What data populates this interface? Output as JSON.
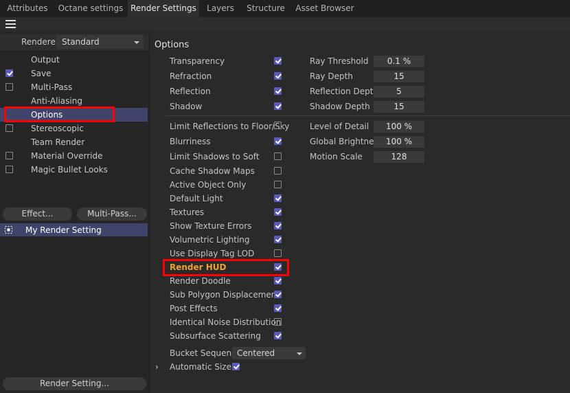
{
  "tabs": [
    {
      "label": "Attributes",
      "active": false
    },
    {
      "label": "Octane settings",
      "active": false
    },
    {
      "label": "Render Settings",
      "active": true
    },
    {
      "label": "Layers",
      "active": false
    },
    {
      "label": "Structure",
      "active": false
    },
    {
      "label": "Asset Browser",
      "active": false
    }
  ],
  "menu": {
    "icon": "hamburger-menu-icon"
  },
  "renderer": {
    "label": "Renderer",
    "value": "Standard"
  },
  "sidebar": {
    "items": [
      {
        "label": "Output",
        "checkbox": null
      },
      {
        "label": "Save",
        "checkbox": true
      },
      {
        "label": "Multi-Pass",
        "checkbox": false
      },
      {
        "label": "Anti-Aliasing",
        "checkbox": null
      },
      {
        "label": "Options",
        "checkbox": null,
        "selected": true
      },
      {
        "label": "Stereoscopic",
        "checkbox": false
      },
      {
        "label": "Team Render",
        "checkbox": null
      },
      {
        "label": "Material Override",
        "checkbox": false
      },
      {
        "label": "Magic Bullet Looks",
        "checkbox": false
      }
    ],
    "effect_button": "Effect...",
    "multipass_button": "Multi-Pass...",
    "render_setting_name": "My Render Setting",
    "render_setting_button": "Render Setting..."
  },
  "options": {
    "title": "Options",
    "group1": [
      {
        "label": "Transparency",
        "checked": true
      },
      {
        "label": "Refraction",
        "checked": true
      },
      {
        "label": "Reflection",
        "checked": true
      },
      {
        "label": "Shadow",
        "checked": true
      }
    ],
    "group1_right": [
      {
        "label": "Ray Threshold",
        "value": "0.1 %"
      },
      {
        "label": "Ray Depth",
        "value": "15"
      },
      {
        "label": "Reflection Depth",
        "value": "5"
      },
      {
        "label": "Shadow Depth",
        "value": "15"
      }
    ],
    "group2": [
      {
        "label": "Limit Reflections to Floor/Sky",
        "checked": false
      },
      {
        "label": "Blurriness",
        "checked": true
      },
      {
        "label": "Limit Shadows to Soft",
        "checked": false
      },
      {
        "label": "Cache Shadow Maps",
        "checked": false
      },
      {
        "label": "Active Object Only",
        "checked": false
      },
      {
        "label": "Default Light",
        "checked": true
      },
      {
        "label": "Textures",
        "checked": true
      },
      {
        "label": "Show Texture Errors",
        "checked": true
      },
      {
        "label": "Volumetric Lighting",
        "checked": true
      },
      {
        "label": "Use Display Tag LOD",
        "checked": false
      },
      {
        "label": "Render HUD",
        "checked": true,
        "highlighted": true
      },
      {
        "label": "Render Doodle",
        "checked": true
      },
      {
        "label": "Sub Polygon Displacement",
        "checked": true
      },
      {
        "label": "Post Effects",
        "checked": true
      },
      {
        "label": "Identical Noise Distribution",
        "checked": false
      },
      {
        "label": "Subsurface Scattering",
        "checked": true
      }
    ],
    "group2_right": [
      {
        "label": "Level of Detail",
        "value": "100 %"
      },
      {
        "label": "Global Brightness",
        "value": "100 %"
      },
      {
        "label": "Motion Scale",
        "value": "128"
      }
    ],
    "bucket_sequence": {
      "label": "Bucket Sequence",
      "value": "Centered"
    },
    "automatic_size": {
      "label": "Automatic Size",
      "checked": true
    }
  },
  "colors": {
    "accent_checkbox": "#5a5bb8",
    "selection": "#40446a",
    "highlight_box": "#ff0000",
    "bold_label": "#f0a030"
  }
}
